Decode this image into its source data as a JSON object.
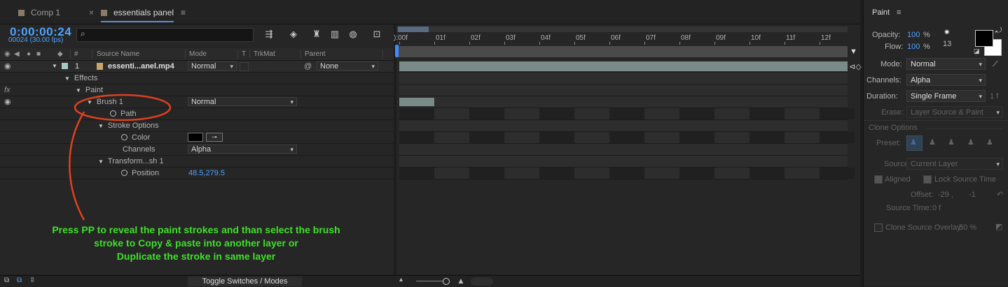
{
  "tabs": [
    {
      "label": "Comp 1"
    },
    {
      "label": "essentials panel"
    }
  ],
  "tab_close": "×",
  "tab_menu": "≡",
  "timecode": "0:00:00:24",
  "frames": "00024 (30.00 fps)",
  "search": {
    "placeholder": "",
    "icon": "⌕"
  },
  "columns": {
    "source": "Source Name",
    "mode": "Mode",
    "t": "T",
    "trkmat": "TrkMat",
    "parent": "Parent",
    "num": "#"
  },
  "layer": {
    "index": "1",
    "name": "essenti...anel.mp4",
    "mode": "Normal",
    "parent": "None"
  },
  "props": {
    "effects": "Effects",
    "paint": "Paint",
    "brush": "Brush 1",
    "brush_mode": "Normal",
    "path": "Path",
    "stroke_options": "Stroke Options",
    "color": "Color",
    "channels": "Channels",
    "channels_value": "Alpha",
    "transform": "Transform...sh 1",
    "position": "Position",
    "position_value": "48.5,279.5"
  },
  "fx_label": "fx",
  "ruler": [
    "00f",
    "01f",
    "02f",
    "03f",
    "04f",
    "05f",
    "06f",
    "07f",
    "08f",
    "09f",
    "10f",
    "11f",
    "12f"
  ],
  "ruler_prefix": "):",
  "bottom": {
    "toggle": "Toggle Switches / Modes"
  },
  "annotation": [
    "Press PP to reveal the paint strokes and than select the brush",
    "stroke to  Copy & paste  into another layer or",
    "Duplicate the stroke in same layer"
  ],
  "paint": {
    "title": "Paint",
    "menu": "≡",
    "opacity_label": "Opacity:",
    "opacity_value": "100",
    "flow_label": "Flow:",
    "flow_value": "100",
    "pct": "%",
    "brush_size": "13",
    "mode_label": "Mode:",
    "mode_value": "Normal",
    "channels_label": "Channels:",
    "channels_value": "Alpha",
    "duration_label": "Duration:",
    "duration_value": "Single Frame",
    "duration_unit": "1  f",
    "erase_label": "Erase:",
    "erase_value": "Layer Source & Paint",
    "clone_options": "Clone Options",
    "preset_label": "Preset:",
    "source_label": "Source:",
    "source_value": "Current Layer",
    "aligned": "Aligned",
    "lock_source": "Lock Source Time",
    "offset_label": "Offset:",
    "offset_value": "-29 ,",
    "offset_value2": "-1",
    "source_time_label": "Source Time:",
    "source_time_value": "0  f",
    "clone_overlay": "Clone Source Overlay:",
    "clone_overlay_value": "50 %"
  },
  "colors": {
    "accent": "#4da3ff",
    "annotation": "#3fe02a",
    "annotation_circle": "#e0401e",
    "track_bar": "#7a8a86"
  }
}
